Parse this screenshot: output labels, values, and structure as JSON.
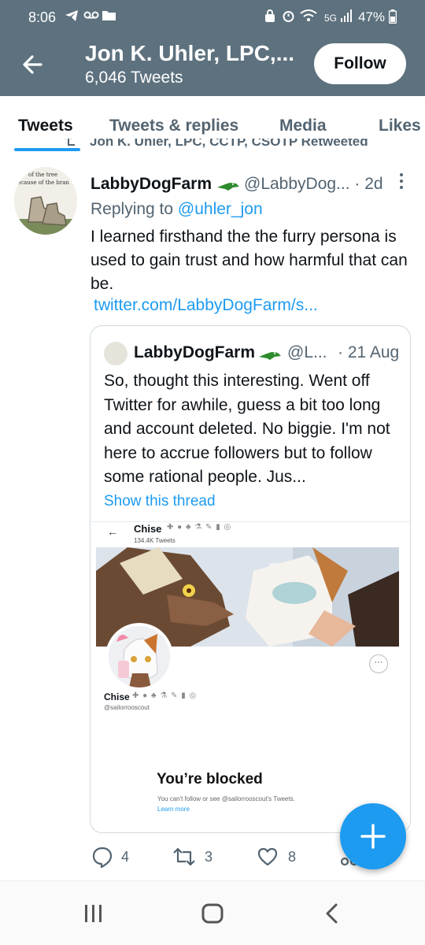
{
  "status_bar": {
    "time": "8:06",
    "network": "5G",
    "battery": "47%"
  },
  "header": {
    "title": "Jon K. Uhler, LPC,...",
    "subtitle": "6,046 Tweets",
    "follow_label": "Follow"
  },
  "tabs": [
    {
      "label": "Tweets",
      "active": true
    },
    {
      "label": "Tweets & replies",
      "active": false
    },
    {
      "label": "Media",
      "active": false
    },
    {
      "label": "Likes",
      "active": false
    }
  ],
  "retweet_context": "Jon K. Uhler, LPC, CCTP, CSOTP Retweeted",
  "tweet": {
    "name": "LabbyDogFarm",
    "handle_time": "@LabbyDog... · 2d",
    "replying_prefix": "Replying to ",
    "replying_to": "@uhler_jon",
    "text": "I learned firsthand the the furry persona is used to gain trust and how harmful that can be.",
    "link": "twitter.com/LabbyDogFarm/s...",
    "avatar_text_1": "of the tree",
    "avatar_text_2": "ecause of the bran"
  },
  "quote": {
    "name": "LabbyDogFarm",
    "handle": "@L...",
    "time": "· 21 Aug",
    "text": "So, thought this interesting.   Went off Twitter for awhile, guess a bit too long and account deleted.  No biggie.  I'm not here to accrue followers but to follow some rational people.  Jus...",
    "show_thread": "Show this thread"
  },
  "embedded": {
    "name": "Chise",
    "tweets": "134.4K Tweets",
    "handle": "@sailorrooscout",
    "blocked_title": "You’re blocked",
    "blocked_sub": "You can't follow or see @sailorrooscout's Tweets.",
    "learn_more": "Learn more"
  },
  "actions": {
    "replies": "4",
    "retweets": "3",
    "likes": "8"
  },
  "colors": {
    "header_bg": "#5d717e",
    "accent": "#1d9bf0",
    "croc": "#2e8b2e"
  }
}
